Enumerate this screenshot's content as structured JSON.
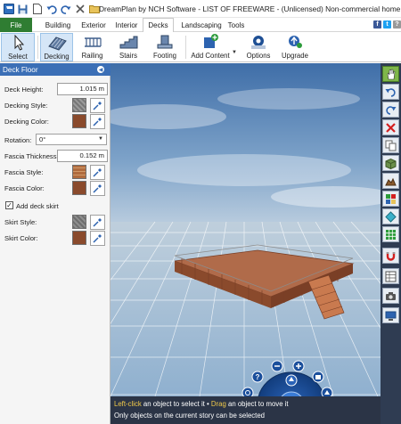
{
  "window": {
    "title": "DreamPlan by NCH Software - LIST OF FREEWARE - (Unlicensed) Non-commercial home ..."
  },
  "quick_access": {
    "icons": [
      "app-icon",
      "save-icon",
      "new-icon",
      "undo-icon",
      "redo-icon",
      "delete-icon",
      "folder-icon"
    ]
  },
  "ribbon": {
    "file_label": "File",
    "tabs": [
      {
        "label": "Building"
      },
      {
        "label": "Exterior"
      },
      {
        "label": "Interior"
      },
      {
        "label": "Decks"
      },
      {
        "label": "Landscaping"
      },
      {
        "label": "Tools"
      }
    ],
    "active_tab": "Decks",
    "colors": {
      "file": "#2f7d32",
      "facebook": "#3b5998",
      "twitter": "#1da1f2"
    }
  },
  "toolbar": {
    "buttons": [
      {
        "label": "Select",
        "icon": "cursor-icon"
      },
      {
        "label": "Decking",
        "icon": "decking-icon"
      },
      {
        "label": "Railing",
        "icon": "railing-icon"
      },
      {
        "label": "Stairs",
        "icon": "stairs-icon"
      },
      {
        "label": "Footing",
        "icon": "footing-icon"
      },
      {
        "label": "Add Content",
        "icon": "add-content-icon"
      },
      {
        "label": "Options",
        "icon": "options-icon"
      },
      {
        "label": "Upgrade",
        "icon": "upgrade-icon"
      }
    ]
  },
  "panel": {
    "title": "Deck Floor",
    "deck_height_label": "Deck Height:",
    "deck_height_value": "1.015 m",
    "decking_style_label": "Decking Style:",
    "decking_color_label": "Decking Color:",
    "rotation_label": "Rotation:",
    "rotation_value": "0°",
    "fascia_thickness_label": "Fascia Thickness:",
    "fascia_thickness_value": "0.152 m",
    "fascia_style_label": "Fascia Style:",
    "fascia_color_label": "Fascia Color:",
    "add_skirt_label": "Add deck skirt",
    "add_skirt_checked": "✓",
    "skirt_style_label": "Skirt Style:",
    "skirt_color_label": "Skirt Color:",
    "colors": {
      "header": "#3b6fb6",
      "wood": "#8a4a2c",
      "gray_pattern": "#8c8c8c",
      "brick": "#b06b3e"
    }
  },
  "status": {
    "line1_a": "Left-click",
    "line1_b": " an object to select it • ",
    "line1_c": "Drag",
    "line1_d": " an object to move it",
    "line2": "Only objects on the current story can be selected"
  },
  "right_toolbar": {
    "icons": [
      "hand-icon",
      "undo-view-icon",
      "redo-view-icon",
      "delete-red-icon",
      "copy-icon",
      "box-icon",
      "terrain-icon",
      "paint-icon",
      "colors-icon",
      "grid-icon",
      "magnet-icon",
      "table-icon",
      "camera-icon",
      "screen-icon"
    ]
  }
}
